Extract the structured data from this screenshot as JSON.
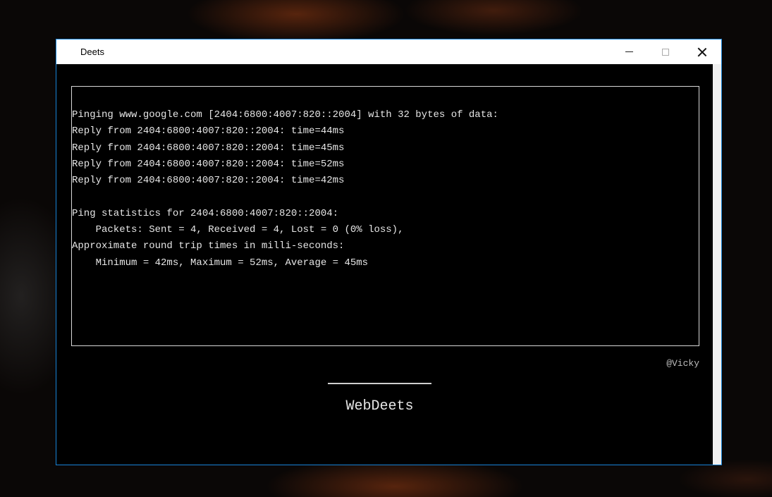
{
  "window": {
    "title": "Deets",
    "controls": {
      "minimize_icon": "minimize-icon",
      "maximize_icon": "maximize-icon",
      "close_icon": "close-icon"
    },
    "accent_border": "#1883d7"
  },
  "console": {
    "lines": [
      "Pinging www.google.com [2404:6800:4007:820::2004] with 32 bytes of data:",
      "Reply from 2404:6800:4007:820::2004: time=44ms",
      "Reply from 2404:6800:4007:820::2004: time=45ms",
      "Reply from 2404:6800:4007:820::2004: time=52ms",
      "Reply from 2404:6800:4007:820::2004: time=42ms",
      "",
      "Ping statistics for 2404:6800:4007:820::2004:",
      "    Packets: Sent = 4, Received = 4, Lost = 0 (0% loss),",
      "Approximate round trip times in milli-seconds:",
      "    Minimum = 42ms, Maximum = 52ms, Average = 45ms"
    ]
  },
  "footer": {
    "credit": "@Vicky",
    "brand": "WebDeets"
  }
}
